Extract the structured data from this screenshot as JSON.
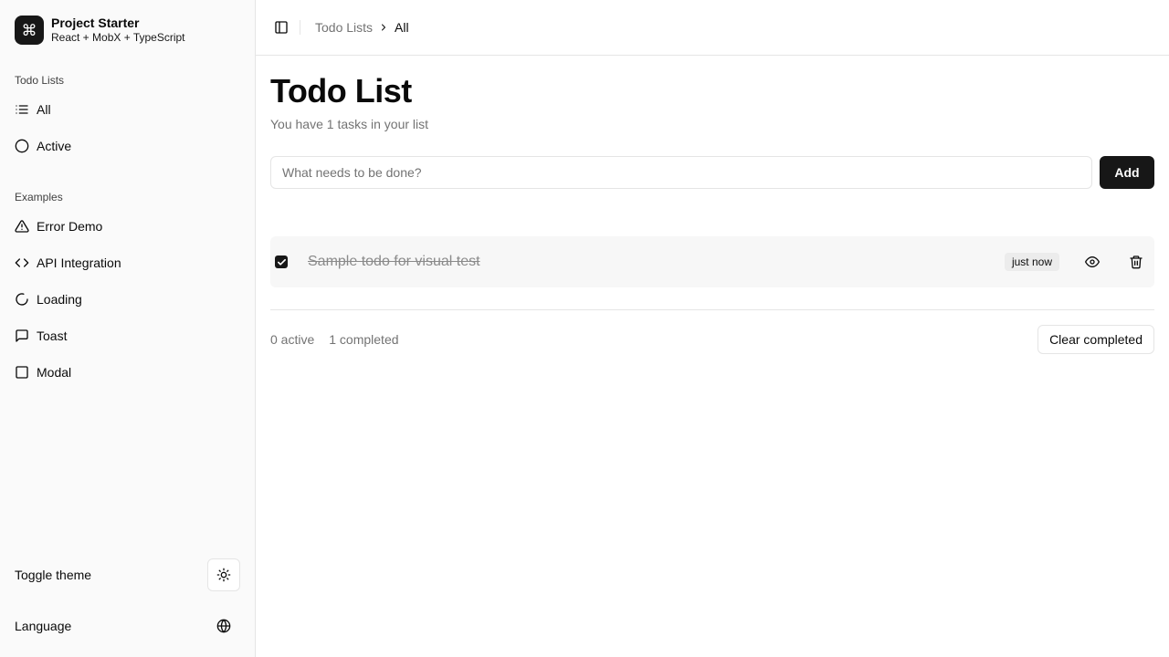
{
  "brand": {
    "name": "Project Starter",
    "subtitle": "React + MobX + TypeScript",
    "logo_icon": "command-icon",
    "logo_glyph": "⌘"
  },
  "sidebar": {
    "todo_group_label": "Todo Lists",
    "todo_items": [
      {
        "label": "All",
        "icon": "list-icon"
      },
      {
        "label": "Active",
        "icon": "circle-icon"
      }
    ],
    "examples_group_label": "Examples",
    "example_items": [
      {
        "label": "Error Demo",
        "icon": "alert-triangle-icon"
      },
      {
        "label": "API Integration",
        "icon": "code-icon"
      },
      {
        "label": "Loading",
        "icon": "loader-icon"
      },
      {
        "label": "Toast",
        "icon": "message-square-icon"
      },
      {
        "label": "Modal",
        "icon": "square-icon"
      }
    ],
    "toggle_theme_label": "Toggle theme",
    "language_label": "Language"
  },
  "breadcrumb": {
    "parent": "Todo Lists",
    "current": "All"
  },
  "page": {
    "title": "Todo List",
    "subtitle": "You have 1 tasks in your list",
    "input_placeholder": "What needs to be done?",
    "add_label": "Add"
  },
  "todos": [
    {
      "text": "Sample todo for visual test",
      "completed": true,
      "time": "just now"
    }
  ],
  "stats": {
    "active": "0 active",
    "completed": "1 completed",
    "clear_label": "Clear completed"
  },
  "colors": {
    "primary": "#171717",
    "muted_text": "#737373",
    "border": "#e5e5e5",
    "sidebar_bg": "#fafafa"
  }
}
